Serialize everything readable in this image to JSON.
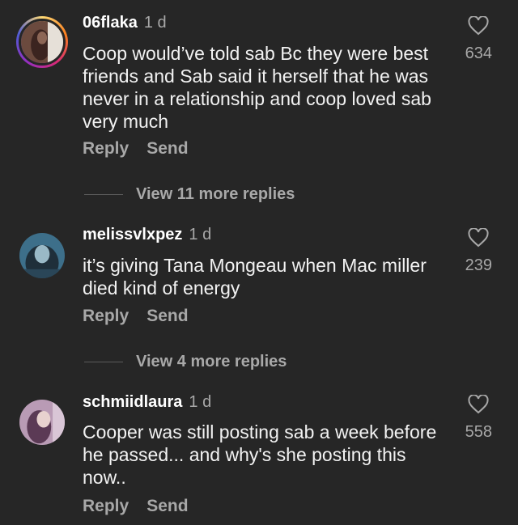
{
  "comments": [
    {
      "username": "06flaka",
      "time": "1 d",
      "text": "Coop would’ve told sab Bc they were best friends and Sab said it herself that he was never in a relationship and coop loved sab very much",
      "likes": "634",
      "reply_label": "Reply",
      "send_label": "Send",
      "more_replies": "View 11 more replies",
      "has_story": true
    },
    {
      "username": "melissvlxpez",
      "time": "1 d",
      "text": "it’s giving Tana Mongeau when Mac miller died kind of energy",
      "likes": "239",
      "reply_label": "Reply",
      "send_label": "Send",
      "more_replies": "View 4 more replies",
      "has_story": false
    },
    {
      "username": "schmiidlaura",
      "time": "1 d",
      "text": "Cooper was still posting sab a week before he passed... and why's she posting this now..",
      "likes": "558",
      "reply_label": "Reply",
      "send_label": "Send",
      "has_story": false
    }
  ],
  "icons": {
    "like": "heart-outline-icon"
  },
  "colors": {
    "background": "#262626",
    "secondary_text": "#a8a8a8"
  }
}
